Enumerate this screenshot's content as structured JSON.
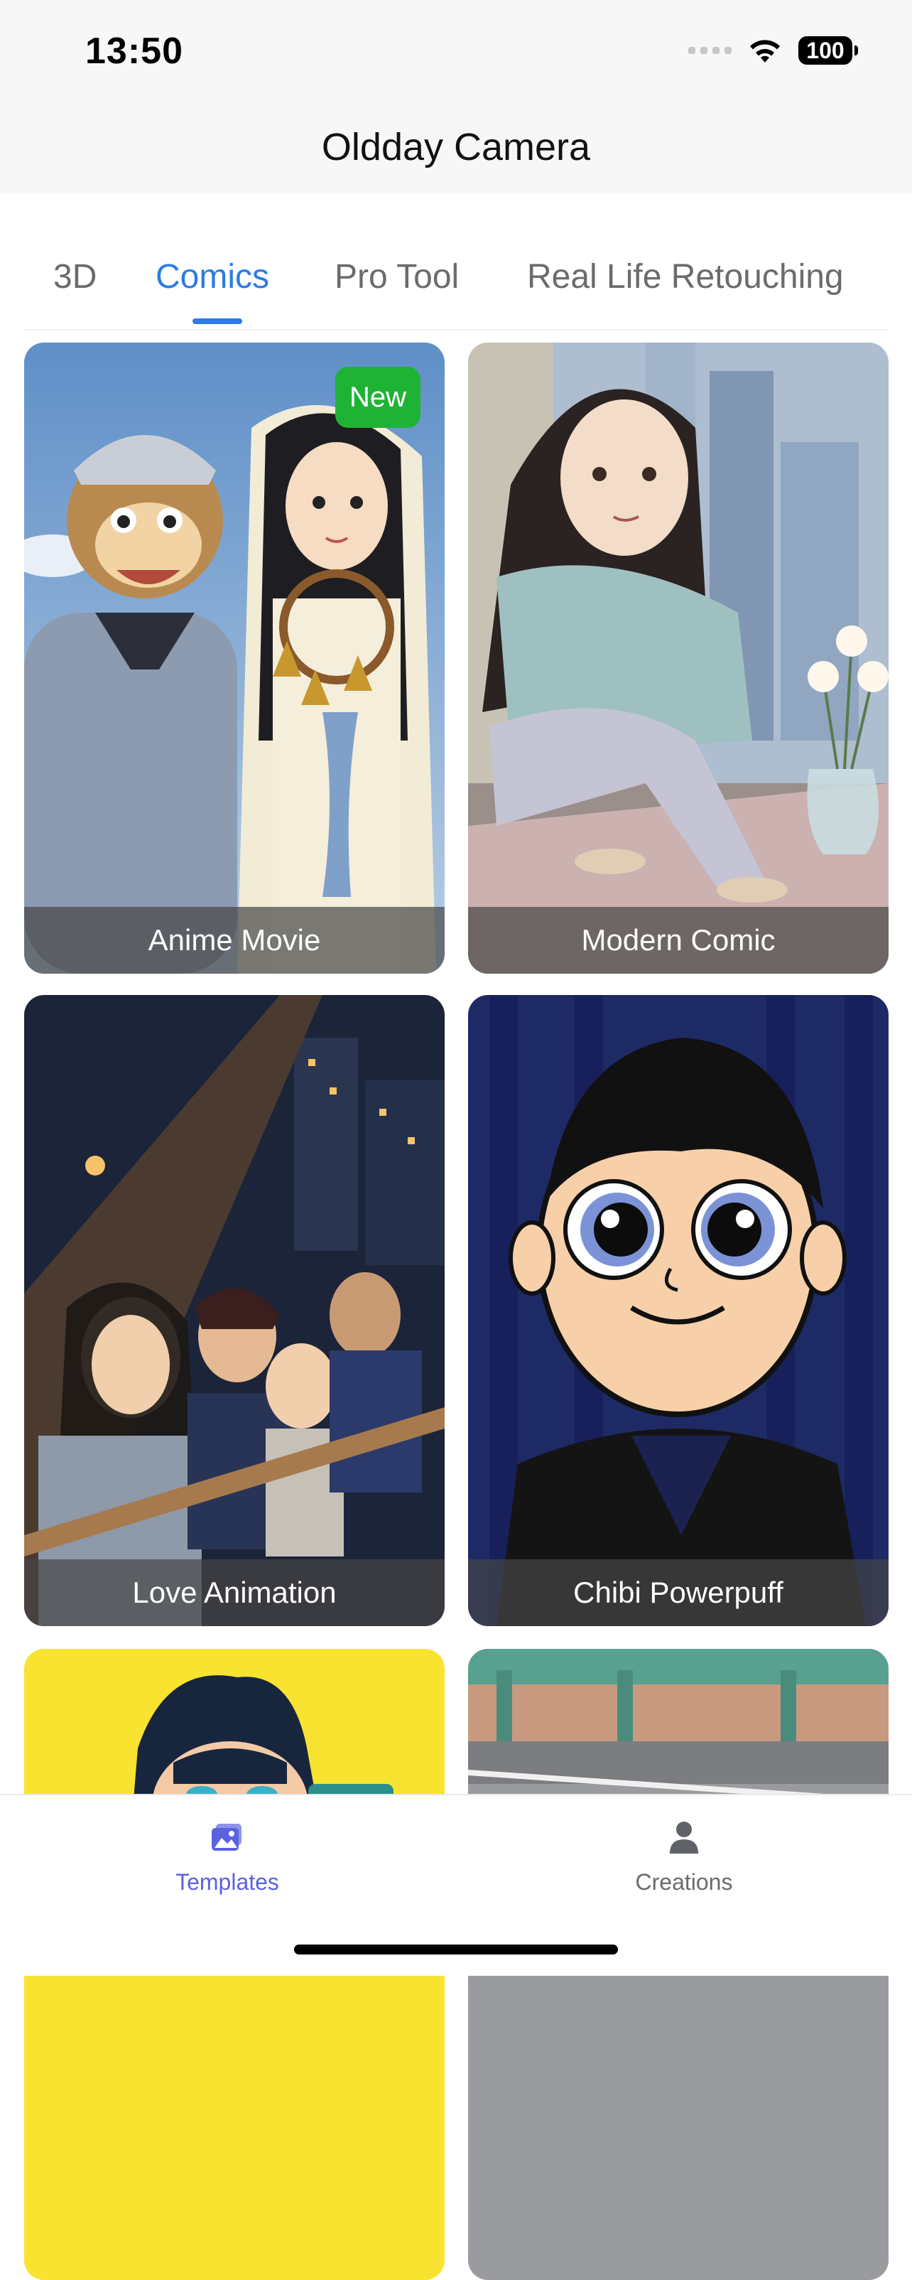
{
  "status_bar": {
    "time": "13:50",
    "battery": "100"
  },
  "header": {
    "title": "Oldday Camera"
  },
  "tabs": [
    {
      "label": "3D"
    },
    {
      "label": "Comics"
    },
    {
      "label": "Pro Tool"
    },
    {
      "label": "Real Life Retouching"
    }
  ],
  "active_tab": "Comics",
  "cards": [
    {
      "label": "Anime Movie",
      "badge": "New"
    },
    {
      "label": "Modern Comic"
    },
    {
      "label": "Love Animation"
    },
    {
      "label": "Chibi Powerpuff"
    }
  ],
  "bottom_nav": [
    {
      "label": "Templates",
      "icon": "templates-icon"
    },
    {
      "label": "Creations",
      "icon": "person-icon"
    }
  ],
  "colors": {
    "accent": "#2d7be5",
    "nav_active": "#5b62e0",
    "badge": "#1fb335"
  }
}
